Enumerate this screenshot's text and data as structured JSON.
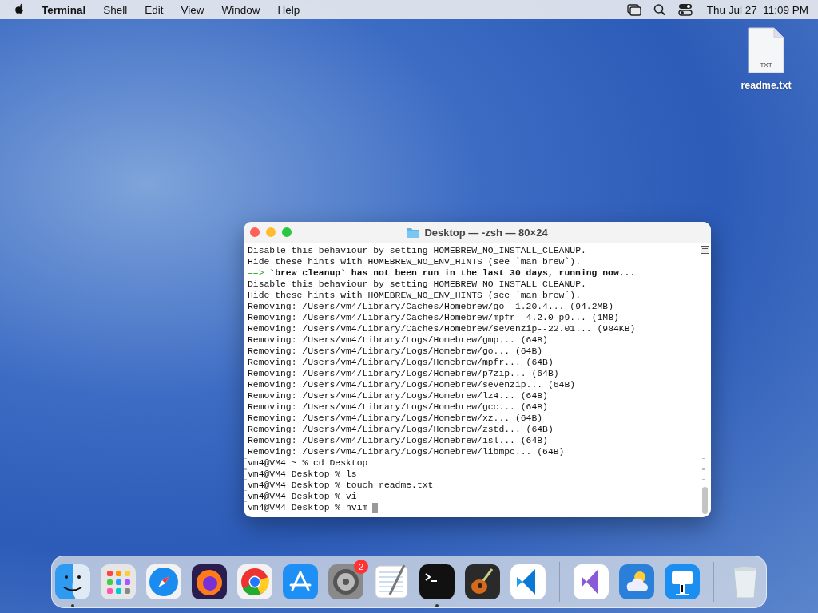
{
  "menu_bar": {
    "app_name": "Terminal",
    "menus": [
      "Shell",
      "Edit",
      "View",
      "Window",
      "Help"
    ],
    "clock": "Thu Jul 27  11:09 PM"
  },
  "desktop_icons": [
    {
      "label": "readme.txt",
      "type_label": "TXT"
    }
  ],
  "terminal": {
    "title": "Desktop — -zsh — 80×24",
    "lines": [
      {
        "kind": "output",
        "text": "Disable this behaviour by setting HOMEBREW_NO_INSTALL_CLEANUP."
      },
      {
        "kind": "output",
        "text": "Hide these hints with HOMEBREW_NO_ENV_HINTS (see `man brew`)."
      },
      {
        "kind": "heading",
        "arrow": "==>",
        "text": "`brew cleanup` has not been run in the last 30 days, running now..."
      },
      {
        "kind": "output",
        "text": "Disable this behaviour by setting HOMEBREW_NO_INSTALL_CLEANUP."
      },
      {
        "kind": "output",
        "text": "Hide these hints with HOMEBREW_NO_ENV_HINTS (see `man brew`)."
      },
      {
        "kind": "output",
        "text": "Removing: /Users/vm4/Library/Caches/Homebrew/go--1.20.4... (94.2MB)"
      },
      {
        "kind": "output",
        "text": "Removing: /Users/vm4/Library/Caches/Homebrew/mpfr--4.2.0-p9... (1MB)"
      },
      {
        "kind": "output",
        "text": "Removing: /Users/vm4/Library/Caches/Homebrew/sevenzip--22.01... (984KB)"
      },
      {
        "kind": "output",
        "text": "Removing: /Users/vm4/Library/Logs/Homebrew/gmp... (64B)"
      },
      {
        "kind": "output",
        "text": "Removing: /Users/vm4/Library/Logs/Homebrew/go... (64B)"
      },
      {
        "kind": "output",
        "text": "Removing: /Users/vm4/Library/Logs/Homebrew/mpfr... (64B)"
      },
      {
        "kind": "output",
        "text": "Removing: /Users/vm4/Library/Logs/Homebrew/p7zip... (64B)"
      },
      {
        "kind": "output",
        "text": "Removing: /Users/vm4/Library/Logs/Homebrew/sevenzip... (64B)"
      },
      {
        "kind": "output",
        "text": "Removing: /Users/vm4/Library/Logs/Homebrew/lz4... (64B)"
      },
      {
        "kind": "output",
        "text": "Removing: /Users/vm4/Library/Logs/Homebrew/gcc... (64B)"
      },
      {
        "kind": "output",
        "text": "Removing: /Users/vm4/Library/Logs/Homebrew/xz... (64B)"
      },
      {
        "kind": "output",
        "text": "Removing: /Users/vm4/Library/Logs/Homebrew/zstd... (64B)"
      },
      {
        "kind": "output",
        "text": "Removing: /Users/vm4/Library/Logs/Homebrew/isl... (64B)"
      },
      {
        "kind": "output",
        "text": "Removing: /Users/vm4/Library/Logs/Homebrew/libmpc... (64B)"
      },
      {
        "kind": "prompt",
        "marked": true,
        "cursor": false,
        "text": "vm4@VM4 ~ % cd Desktop"
      },
      {
        "kind": "prompt",
        "marked": true,
        "cursor": false,
        "text": "vm4@VM4 Desktop % ls"
      },
      {
        "kind": "prompt",
        "marked": true,
        "cursor": false,
        "text": "vm4@VM4 Desktop % touch readme.txt"
      },
      {
        "kind": "prompt",
        "marked": true,
        "cursor": false,
        "text": "vm4@VM4 Desktop % vi"
      },
      {
        "kind": "prompt",
        "marked": false,
        "cursor": true,
        "text": "vm4@VM4 Desktop % nvim"
      }
    ]
  },
  "dock": {
    "items": [
      {
        "kind": "finder",
        "running": true
      },
      {
        "kind": "launchpad",
        "running": false
      },
      {
        "kind": "safari",
        "running": false
      },
      {
        "kind": "firefox",
        "running": false
      },
      {
        "kind": "chrome",
        "running": false
      },
      {
        "kind": "appstore",
        "running": false
      },
      {
        "kind": "settings",
        "running": false,
        "badge": "2"
      },
      {
        "kind": "textedit",
        "running": false
      },
      {
        "kind": "terminal",
        "running": true
      },
      {
        "kind": "garageband",
        "running": false
      },
      {
        "kind": "vscode",
        "running": false
      },
      {
        "kind": "separator"
      },
      {
        "kind": "visualstudio",
        "running": false
      },
      {
        "kind": "weather",
        "running": false
      },
      {
        "kind": "keynote",
        "running": false
      },
      {
        "kind": "separator"
      },
      {
        "kind": "trash",
        "running": false
      }
    ]
  }
}
